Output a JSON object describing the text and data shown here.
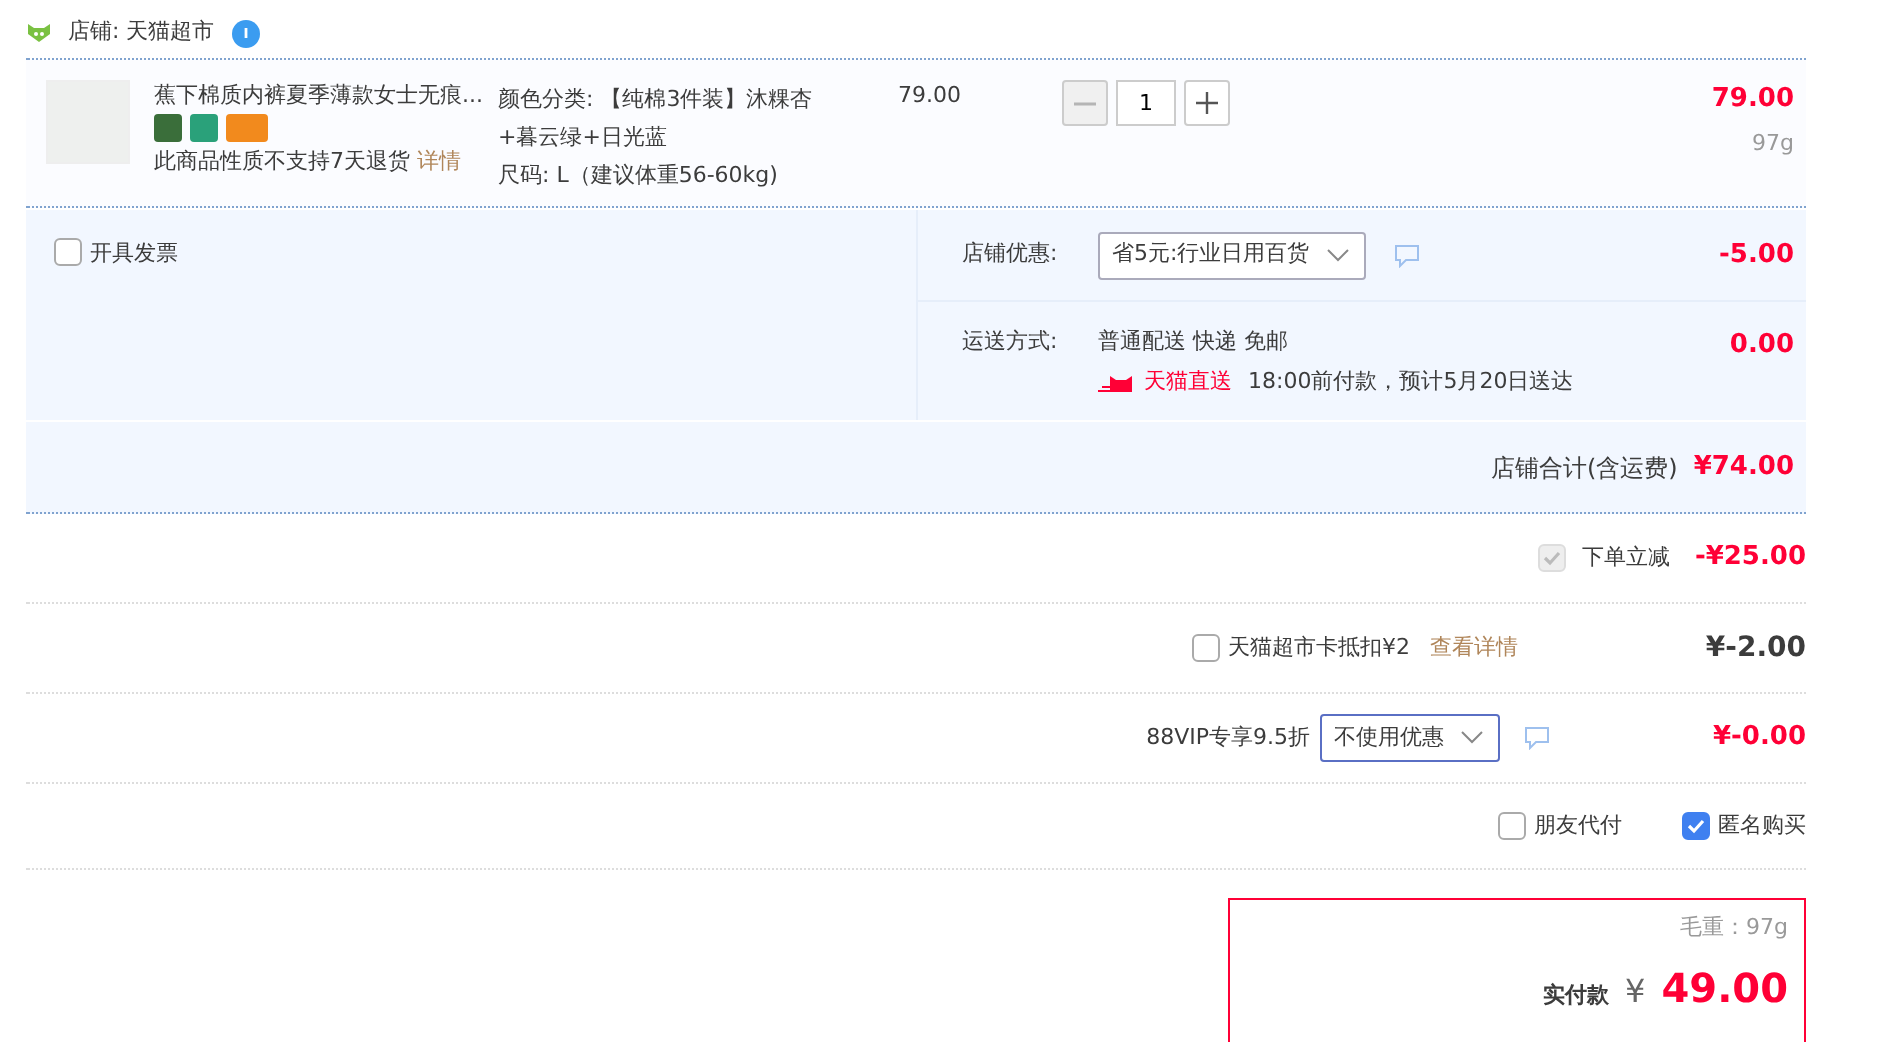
{
  "shop": {
    "label": "店铺: 天猫超市"
  },
  "item": {
    "title": "蕉下棉质内裤夏季薄款女士无痕...",
    "note": "此商品性质不支持7天退货",
    "note_link": "详情",
    "sku": [
      "颜色分类: 【纯棉3件装】沐粿杏",
      "+暮云绿+日光蓝",
      "尺码: L（建议体重56-60kg)"
    ],
    "unit_price": "79.00",
    "quantity": "1",
    "total": "79.00",
    "weight": "97g"
  },
  "invoice": {
    "label": "开具发票",
    "checked": false
  },
  "shop_discount": {
    "label": "店铺优惠:",
    "selected_option": "省5元:行业日用百货",
    "amount": "-5.00"
  },
  "shipping": {
    "label": "运送方式:",
    "method": "普通配送 快递 免邮",
    "carrier": "天猫直送",
    "eta": "18:00前付款，预计5月20日送达",
    "amount": "0.00"
  },
  "shop_total": {
    "label": "店铺合计(含运费)",
    "amount": "¥74.00"
  },
  "instant_discount": {
    "label": "下单立减",
    "checked": true,
    "disabled": true,
    "amount": "-¥25.00"
  },
  "card_deduction": {
    "label": "天猫超市卡抵扣¥2",
    "checked": false,
    "link": "查看详情",
    "amount": "¥-2.00"
  },
  "vip": {
    "label": "88VIP专享9.5折",
    "selected_option": "不使用优惠",
    "amount": "¥-0.00"
  },
  "options": [
    {
      "label": "朋友代付",
      "checked": false
    },
    {
      "label": "匿名购买",
      "checked": true
    }
  ],
  "summary": {
    "weight": "毛重：97g",
    "label": "实付款",
    "currency": "¥",
    "amount": "49.00"
  }
}
